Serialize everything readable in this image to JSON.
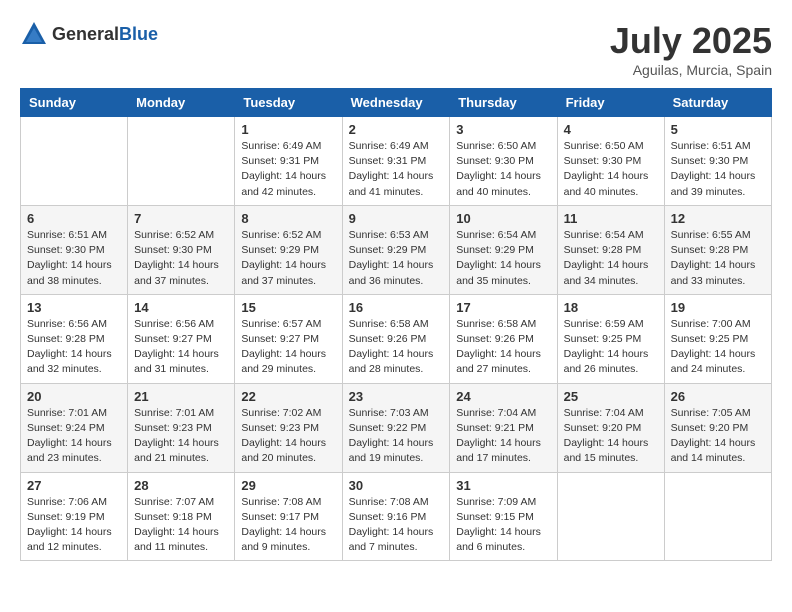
{
  "header": {
    "logo_general": "General",
    "logo_blue": "Blue",
    "month_year": "July 2025",
    "location": "Aguilas, Murcia, Spain"
  },
  "days_of_week": [
    "Sunday",
    "Monday",
    "Tuesday",
    "Wednesday",
    "Thursday",
    "Friday",
    "Saturday"
  ],
  "weeks": [
    [
      {
        "day": "",
        "content": ""
      },
      {
        "day": "",
        "content": ""
      },
      {
        "day": "1",
        "content": "Sunrise: 6:49 AM\nSunset: 9:31 PM\nDaylight: 14 hours and 42 minutes."
      },
      {
        "day": "2",
        "content": "Sunrise: 6:49 AM\nSunset: 9:31 PM\nDaylight: 14 hours and 41 minutes."
      },
      {
        "day": "3",
        "content": "Sunrise: 6:50 AM\nSunset: 9:30 PM\nDaylight: 14 hours and 40 minutes."
      },
      {
        "day": "4",
        "content": "Sunrise: 6:50 AM\nSunset: 9:30 PM\nDaylight: 14 hours and 40 minutes."
      },
      {
        "day": "5",
        "content": "Sunrise: 6:51 AM\nSunset: 9:30 PM\nDaylight: 14 hours and 39 minutes."
      }
    ],
    [
      {
        "day": "6",
        "content": "Sunrise: 6:51 AM\nSunset: 9:30 PM\nDaylight: 14 hours and 38 minutes."
      },
      {
        "day": "7",
        "content": "Sunrise: 6:52 AM\nSunset: 9:30 PM\nDaylight: 14 hours and 37 minutes."
      },
      {
        "day": "8",
        "content": "Sunrise: 6:52 AM\nSunset: 9:29 PM\nDaylight: 14 hours and 37 minutes."
      },
      {
        "day": "9",
        "content": "Sunrise: 6:53 AM\nSunset: 9:29 PM\nDaylight: 14 hours and 36 minutes."
      },
      {
        "day": "10",
        "content": "Sunrise: 6:54 AM\nSunset: 9:29 PM\nDaylight: 14 hours and 35 minutes."
      },
      {
        "day": "11",
        "content": "Sunrise: 6:54 AM\nSunset: 9:28 PM\nDaylight: 14 hours and 34 minutes."
      },
      {
        "day": "12",
        "content": "Sunrise: 6:55 AM\nSunset: 9:28 PM\nDaylight: 14 hours and 33 minutes."
      }
    ],
    [
      {
        "day": "13",
        "content": "Sunrise: 6:56 AM\nSunset: 9:28 PM\nDaylight: 14 hours and 32 minutes."
      },
      {
        "day": "14",
        "content": "Sunrise: 6:56 AM\nSunset: 9:27 PM\nDaylight: 14 hours and 31 minutes."
      },
      {
        "day": "15",
        "content": "Sunrise: 6:57 AM\nSunset: 9:27 PM\nDaylight: 14 hours and 29 minutes."
      },
      {
        "day": "16",
        "content": "Sunrise: 6:58 AM\nSunset: 9:26 PM\nDaylight: 14 hours and 28 minutes."
      },
      {
        "day": "17",
        "content": "Sunrise: 6:58 AM\nSunset: 9:26 PM\nDaylight: 14 hours and 27 minutes."
      },
      {
        "day": "18",
        "content": "Sunrise: 6:59 AM\nSunset: 9:25 PM\nDaylight: 14 hours and 26 minutes."
      },
      {
        "day": "19",
        "content": "Sunrise: 7:00 AM\nSunset: 9:25 PM\nDaylight: 14 hours and 24 minutes."
      }
    ],
    [
      {
        "day": "20",
        "content": "Sunrise: 7:01 AM\nSunset: 9:24 PM\nDaylight: 14 hours and 23 minutes."
      },
      {
        "day": "21",
        "content": "Sunrise: 7:01 AM\nSunset: 9:23 PM\nDaylight: 14 hours and 21 minutes."
      },
      {
        "day": "22",
        "content": "Sunrise: 7:02 AM\nSunset: 9:23 PM\nDaylight: 14 hours and 20 minutes."
      },
      {
        "day": "23",
        "content": "Sunrise: 7:03 AM\nSunset: 9:22 PM\nDaylight: 14 hours and 19 minutes."
      },
      {
        "day": "24",
        "content": "Sunrise: 7:04 AM\nSunset: 9:21 PM\nDaylight: 14 hours and 17 minutes."
      },
      {
        "day": "25",
        "content": "Sunrise: 7:04 AM\nSunset: 9:20 PM\nDaylight: 14 hours and 15 minutes."
      },
      {
        "day": "26",
        "content": "Sunrise: 7:05 AM\nSunset: 9:20 PM\nDaylight: 14 hours and 14 minutes."
      }
    ],
    [
      {
        "day": "27",
        "content": "Sunrise: 7:06 AM\nSunset: 9:19 PM\nDaylight: 14 hours and 12 minutes."
      },
      {
        "day": "28",
        "content": "Sunrise: 7:07 AM\nSunset: 9:18 PM\nDaylight: 14 hours and 11 minutes."
      },
      {
        "day": "29",
        "content": "Sunrise: 7:08 AM\nSunset: 9:17 PM\nDaylight: 14 hours and 9 minutes."
      },
      {
        "day": "30",
        "content": "Sunrise: 7:08 AM\nSunset: 9:16 PM\nDaylight: 14 hours and 7 minutes."
      },
      {
        "day": "31",
        "content": "Sunrise: 7:09 AM\nSunset: 9:15 PM\nDaylight: 14 hours and 6 minutes."
      },
      {
        "day": "",
        "content": ""
      },
      {
        "day": "",
        "content": ""
      }
    ]
  ]
}
